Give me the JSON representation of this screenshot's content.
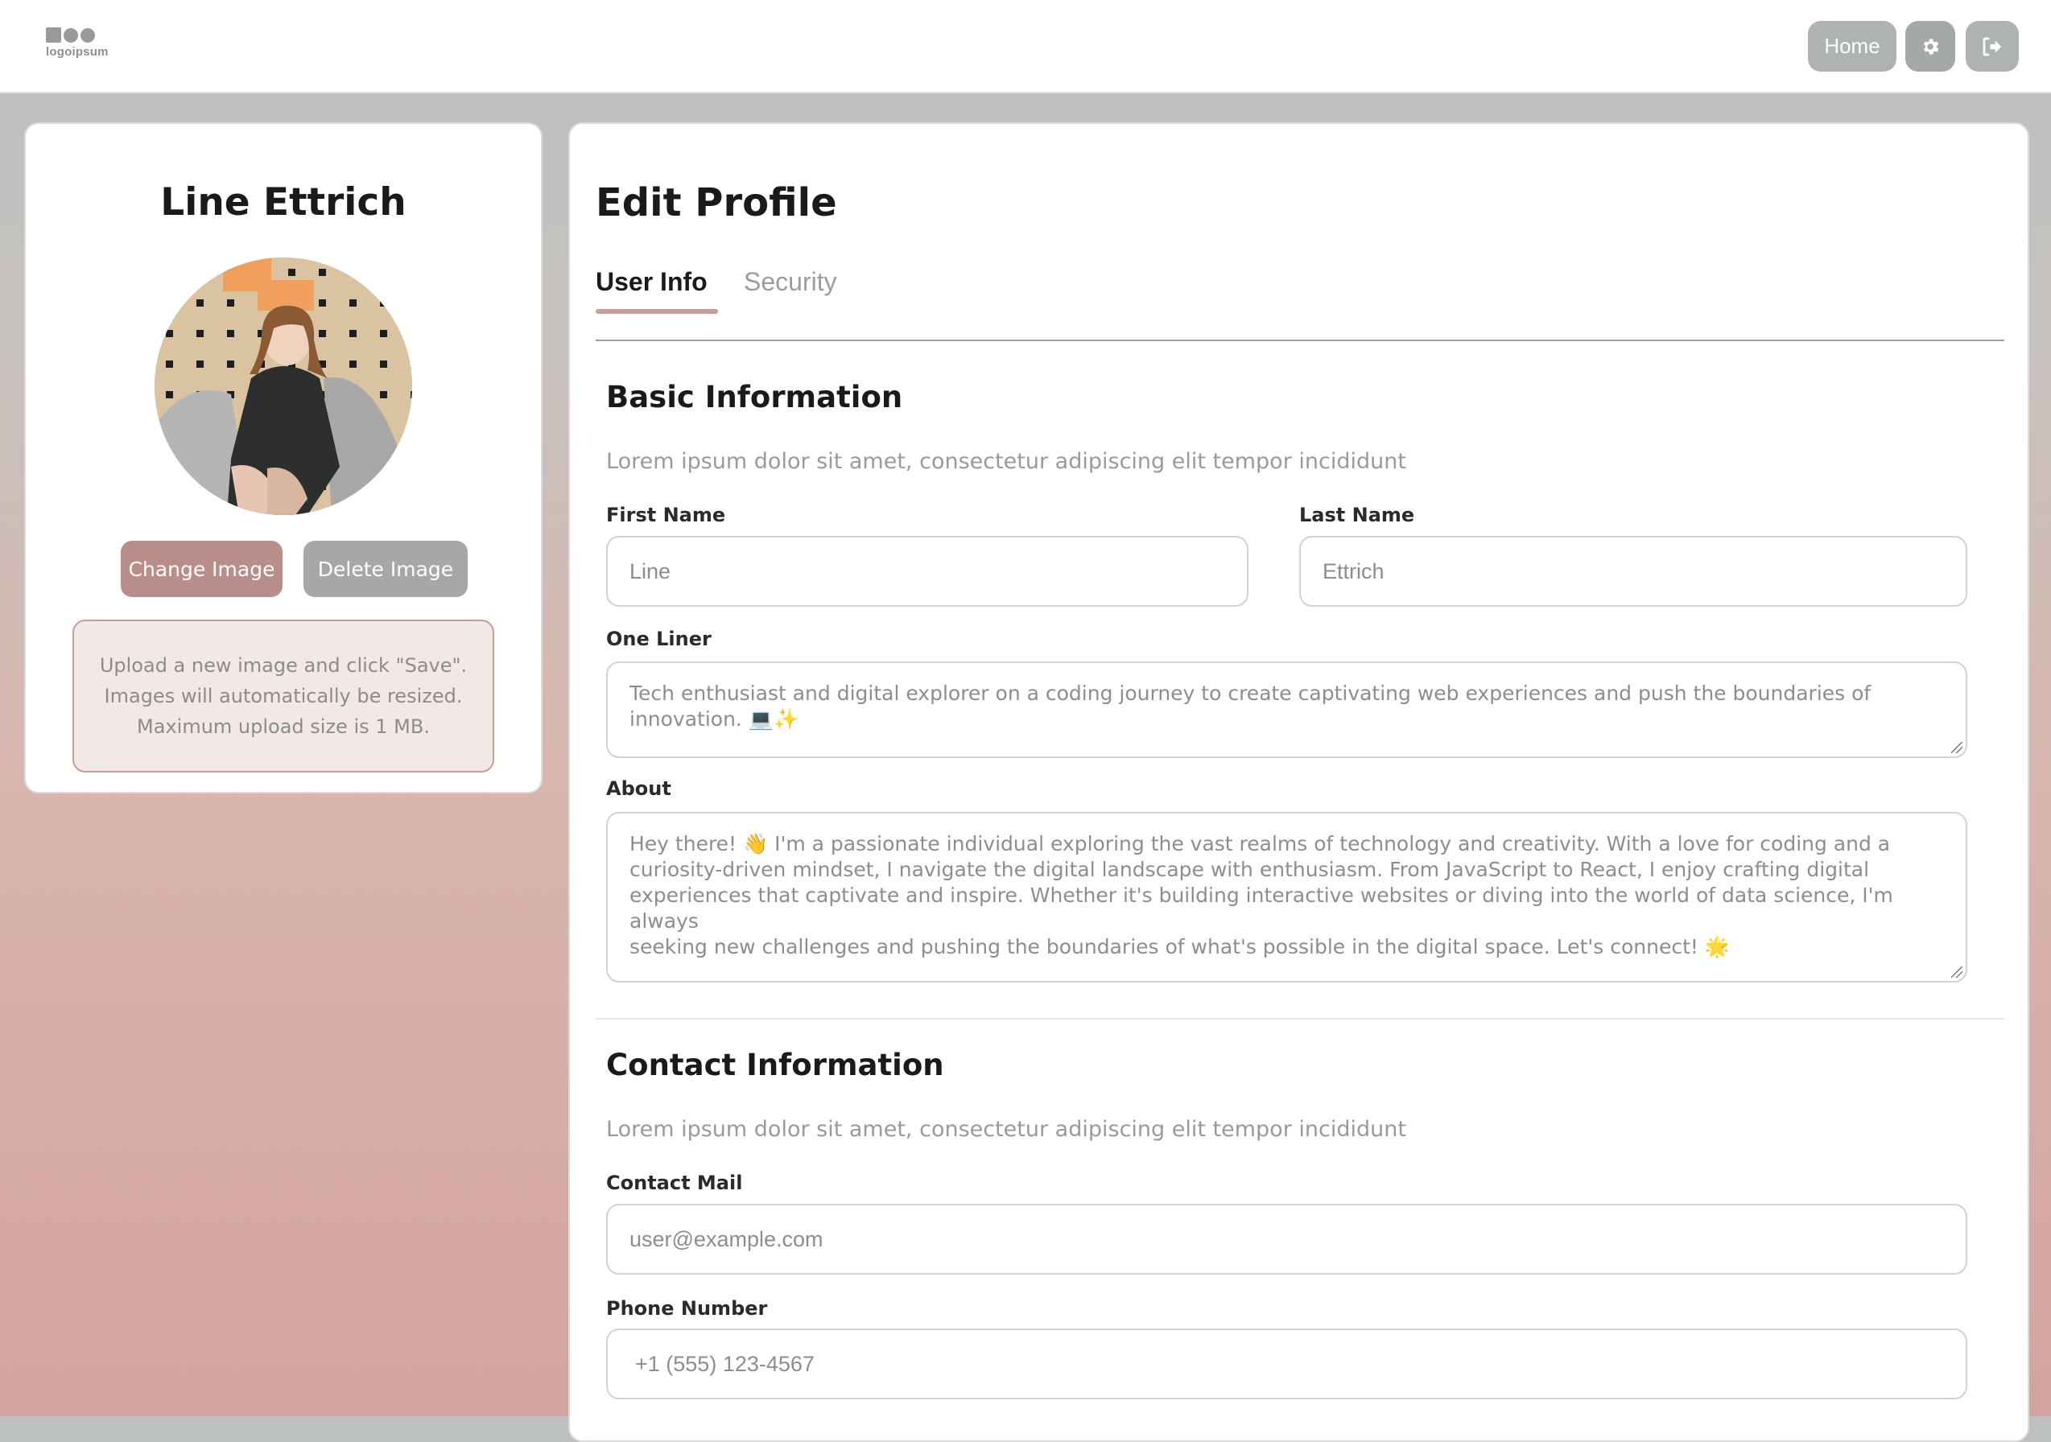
{
  "header": {
    "logo_text": "logoipsum",
    "home_label": "Home",
    "settings_icon": "gear-icon",
    "logout_icon": "sign-out-icon"
  },
  "profile": {
    "name": "Line Ettrich",
    "change_image_label": "Change Image",
    "delete_image_label": "Delete Image",
    "upload_info": [
      "Upload a new image and click \"Save\".",
      "Images will automatically be resized.",
      "Maximum upload size is 1 MB."
    ]
  },
  "edit": {
    "title": "Edit Profile",
    "tabs": [
      {
        "label": "User Info",
        "active": true
      },
      {
        "label": "Security",
        "active": false
      }
    ]
  },
  "basic": {
    "title": "Basic Information",
    "description": "Lorem ipsum dolor sit amet, consectetur adipiscing elit tempor incididunt",
    "first_name_label": "First Name",
    "first_name_placeholder": "Line",
    "last_name_label": "Last Name",
    "last_name_placeholder": "Ettrich",
    "one_liner_label": "One Liner",
    "one_liner_lines": [
      "Tech enthusiast and digital explorer on a coding journey to create captivating web experiences and push the boundaries of",
      "innovation. 💻✨"
    ],
    "about_label": "About",
    "about_lines": [
      "Hey there! 👋 I'm a passionate individual exploring the vast realms of technology and creativity. With a love for coding and a",
      "curiosity-driven mindset, I navigate the digital landscape with enthusiasm. From JavaScript to React, I enjoy crafting digital",
      "experiences that captivate and inspire. Whether it's building interactive websites or diving into the world of data science, I'm always",
      "seeking new challenges and pushing the boundaries of what's possible in the digital space. Let's connect! 🌟"
    ]
  },
  "contact": {
    "title": "Contact Information",
    "description": "Lorem ipsum dolor sit amet, consectetur adipiscing elit tempor incididunt",
    "mail_label": "Contact Mail",
    "mail_placeholder": "user@example.com",
    "phone_label": "Phone Number",
    "phone_placeholder": "+1 (555) 123-4567"
  },
  "colors": {
    "accent": "#c59f99",
    "primary_button": "#b98d8a",
    "secondary_button": "#a9a6a6",
    "nav_button": "#aeb2b2"
  }
}
